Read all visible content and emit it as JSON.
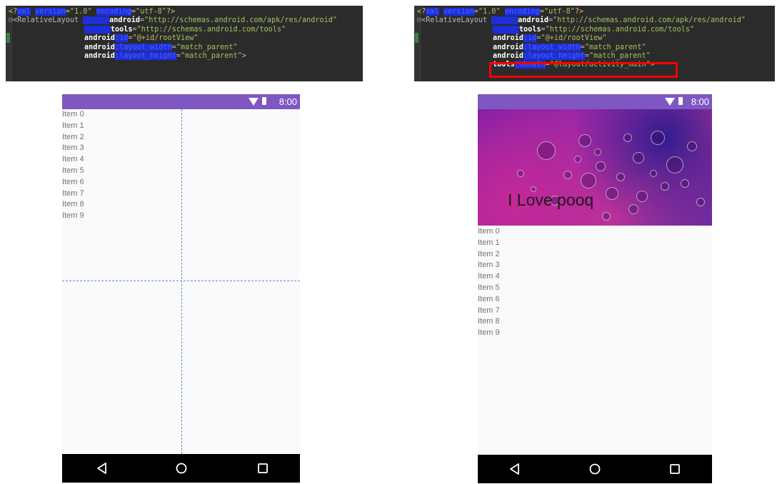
{
  "left_editor": {
    "lines": [
      {
        "parts": [
          {
            "c": "tag",
            "t": "<?"
          },
          {
            "c": "hl-attr",
            "t": "xml"
          },
          {
            "c": "attr",
            "t": " "
          },
          {
            "c": "hl-attr",
            "t": "version"
          },
          {
            "c": "attr",
            "t": "="
          },
          {
            "c": "str",
            "t": "\"1.0\""
          },
          {
            "c": "attr",
            "t": " "
          },
          {
            "c": "hl-attr",
            "t": "encoding"
          },
          {
            "c": "attr",
            "t": "="
          },
          {
            "c": "str",
            "t": "\"utf-8\""
          },
          {
            "c": "tag",
            "t": "?>"
          }
        ]
      },
      {
        "parts": [
          {
            "c": "fold",
            "t": "⊟"
          },
          {
            "c": "attr",
            "t": "<RelativeLayout "
          },
          {
            "c": "hl-ns",
            "t": "xmlns:"
          },
          {
            "c": "nsname",
            "t": "android"
          },
          {
            "c": "attr",
            "t": "="
          },
          {
            "c": "str",
            "t": "\"http://schemas.android.com/apk/res/android\""
          }
        ]
      },
      {
        "indent": true,
        "parts": [
          {
            "c": "hl-ns",
            "t": "xmlns:"
          },
          {
            "c": "nsname",
            "t": "tools"
          },
          {
            "c": "attr",
            "t": "="
          },
          {
            "c": "str",
            "t": "\"http://schemas.android.com/tools\""
          }
        ]
      },
      {
        "indent": true,
        "parts": [
          {
            "c": "nsname",
            "t": "android"
          },
          {
            "c": "hl-attr",
            "t": ":id"
          },
          {
            "c": "attr",
            "t": "="
          },
          {
            "c": "str",
            "t": "\"@+id/rootView\""
          }
        ]
      },
      {
        "indent": true,
        "parts": [
          {
            "c": "nsname",
            "t": "android"
          },
          {
            "c": "hl-attr",
            "t": ":layout_width"
          },
          {
            "c": "attr",
            "t": "="
          },
          {
            "c": "str",
            "t": "\"match_parent\""
          }
        ]
      },
      {
        "indent": true,
        "parts": [
          {
            "c": "nsname",
            "t": "android"
          },
          {
            "c": "hl-attr",
            "t": ":layout_height"
          },
          {
            "c": "attr",
            "t": "="
          },
          {
            "c": "str",
            "t": "\"match_parent\""
          },
          {
            "c": "attr",
            "t": ">"
          }
        ]
      }
    ]
  },
  "right_editor": {
    "lines": [
      {
        "parts": [
          {
            "c": "tag",
            "t": "<?"
          },
          {
            "c": "hl-attr",
            "t": "xml"
          },
          {
            "c": "attr",
            "t": " "
          },
          {
            "c": "hl-attr",
            "t": "version"
          },
          {
            "c": "attr",
            "t": "="
          },
          {
            "c": "str",
            "t": "\"1.0\""
          },
          {
            "c": "attr",
            "t": " "
          },
          {
            "c": "hl-attr",
            "t": "encoding"
          },
          {
            "c": "attr",
            "t": "="
          },
          {
            "c": "str",
            "t": "\"utf-8\""
          },
          {
            "c": "tag",
            "t": "?>"
          }
        ]
      },
      {
        "parts": [
          {
            "c": "fold",
            "t": "⊟"
          },
          {
            "c": "attr",
            "t": "<RelativeLayout "
          },
          {
            "c": "hl-ns",
            "t": "xmlns:"
          },
          {
            "c": "nsname",
            "t": "android"
          },
          {
            "c": "attr",
            "t": "="
          },
          {
            "c": "str",
            "t": "\"http://schemas.android.com/apk/res/android\""
          }
        ]
      },
      {
        "indent": true,
        "parts": [
          {
            "c": "hl-ns",
            "t": "xmlns:"
          },
          {
            "c": "nsname",
            "t": "tools"
          },
          {
            "c": "attr",
            "t": "="
          },
          {
            "c": "str",
            "t": "\"http://schemas.android.com/tools\""
          }
        ]
      },
      {
        "indent": true,
        "parts": [
          {
            "c": "nsname",
            "t": "android"
          },
          {
            "c": "hl-attr",
            "t": ":id"
          },
          {
            "c": "attr",
            "t": "="
          },
          {
            "c": "str",
            "t": "\"@+id/rootView\""
          }
        ]
      },
      {
        "indent": true,
        "parts": [
          {
            "c": "nsname",
            "t": "android"
          },
          {
            "c": "hl-attr",
            "t": ":layout_width"
          },
          {
            "c": "attr",
            "t": "="
          },
          {
            "c": "str",
            "t": "\"match_parent\""
          }
        ]
      },
      {
        "indent": true,
        "parts": [
          {
            "c": "nsname",
            "t": "android"
          },
          {
            "c": "hl-attr",
            "t": ":layout_height"
          },
          {
            "c": "attr",
            "t": "="
          },
          {
            "c": "str",
            "t": "\"match_parent\""
          }
        ]
      },
      {
        "indent": true,
        "parts": [
          {
            "c": "nsname",
            "t": "tools"
          },
          {
            "c": "hl-attr",
            "t": ":showIn"
          },
          {
            "c": "attr",
            "t": "="
          },
          {
            "c": "str",
            "t": "\"@layout/activity_main\""
          },
          {
            "c": "attr",
            "t": ">"
          }
        ]
      }
    ]
  },
  "left_phone": {
    "status_time": "8:00",
    "items": [
      "Item 0",
      "Item 1",
      "Item 2",
      "Item 3",
      "Item 4",
      "Item 5",
      "Item 6",
      "Item 7",
      "Item 8",
      "Item 9"
    ]
  },
  "right_phone": {
    "status_time": "8:00",
    "banner_text": "I Love pooq",
    "items": [
      "Item 0",
      "Item 1",
      "Item 2",
      "Item 3",
      "Item 4",
      "Item 5",
      "Item 6",
      "Item 7",
      "Item 8",
      "Item 9"
    ]
  },
  "nav_icons": [
    "back-icon",
    "home-icon",
    "recents-icon"
  ],
  "colors": {
    "status_bar": "#7e57c2",
    "highlight_box": "#ff0000",
    "guide_lines": "#5b8fdc"
  }
}
